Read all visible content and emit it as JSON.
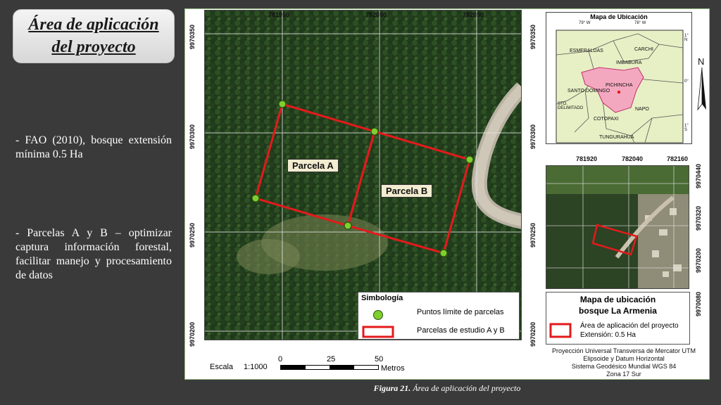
{
  "slide": {
    "title_line1": "Área de aplicación",
    "title_line2": "del proyecto",
    "bullet1": "- FAO (2010), bosque extensión mínima 0.5 Ha",
    "bullet2": "- Parcelas A y B – optimizar captura información forestal, facilitar manejo y procesamiento de datos",
    "caption_label": "Figura 21.",
    "caption_text": "Área de aplicación del proyecto"
  },
  "main_map": {
    "x_ticks": [
      "781950",
      "782000",
      "782050"
    ],
    "y_ticks": [
      "9970350",
      "9970300",
      "9970250",
      "9970200"
    ],
    "parcel_a_label": "Parcela A",
    "parcel_b_label": "Parcela B",
    "parcel_color": "#e31a1c",
    "point_color": "#7fcf2e"
  },
  "legend": {
    "title": "Simbología",
    "points_label": "Puntos límite de parcelas",
    "parcels_label": "Parcelas de estudio A y B"
  },
  "scale": {
    "label": "Escala",
    "ratio": "1:1000",
    "ticks": [
      "0",
      "25",
      "50"
    ],
    "unit": "Metros"
  },
  "locator": {
    "title": "Mapa de Ubicación",
    "provinces": [
      "ESMERALDAS",
      "CARCHI",
      "IMBABURA",
      "PICHINCHA",
      "SANTO DOMINGO",
      "STO. DELIMITADO",
      "NAPO",
      "COTOPAXI",
      "TUNGURAHUA"
    ],
    "lon_ticks": [
      "79° W",
      "78° W"
    ],
    "lat_ticks": [
      "1° N",
      "0°",
      "1° S"
    ],
    "highlight_color": "#f4a8c0"
  },
  "north": {
    "label": "N"
  },
  "inset": {
    "x_ticks": [
      "781920",
      "782040",
      "782160"
    ],
    "y_ticks": [
      "9970440",
      "9970320",
      "9970200",
      "9970080"
    ],
    "title_line1": "Mapa de ubicación",
    "title_line2": "bosque La Armenia",
    "legend_line1": "Área de aplicación del proyecto",
    "legend_line2": "Extensión: 0.5 Ha"
  },
  "projection": {
    "line1": "Proyección Universal Transversa de Mercator UTM",
    "line2": "Elipsoide y Datum Horizontal",
    "line3": "Sistema Geodésico Mundial WGS 84",
    "line4": "Zona 17 Sur"
  }
}
